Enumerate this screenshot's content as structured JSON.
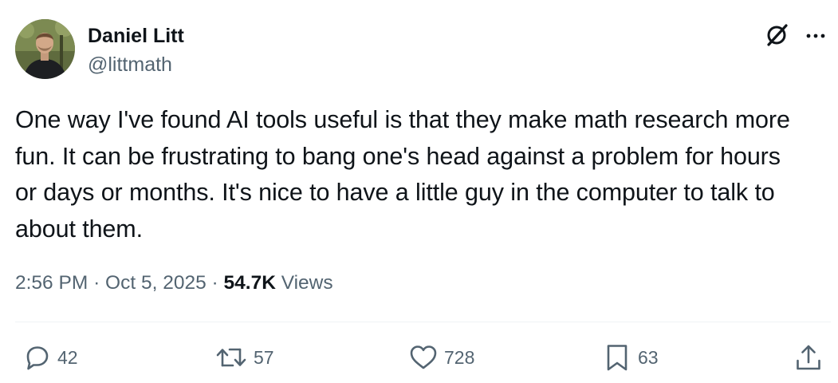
{
  "author": {
    "display_name": "Daniel Litt",
    "handle": "@littmath"
  },
  "post": {
    "text": "One way I've found AI tools useful is that they make math research more\nfun. It can be frustrating to bang one's head against a problem for hours\nor days or months. It's nice to have a little guy in the computer to talk to\nabout them.",
    "time": "2:56 PM",
    "date": "Oct 5, 2025",
    "separator": "·",
    "views_count": "54.7K",
    "views_label": "Views"
  },
  "actions": {
    "replies": "42",
    "reposts": "57",
    "likes": "728",
    "bookmarks": "63"
  },
  "icons": {
    "top_right": [
      "grok-icon",
      "more-icon"
    ],
    "actions": [
      "reply-icon",
      "repost-icon",
      "like-icon",
      "bookmark-icon",
      "share-icon"
    ]
  },
  "colors": {
    "text_primary": "#0f1419",
    "text_secondary": "#536471",
    "divider": "#eff3f4",
    "background": "#ffffff"
  }
}
